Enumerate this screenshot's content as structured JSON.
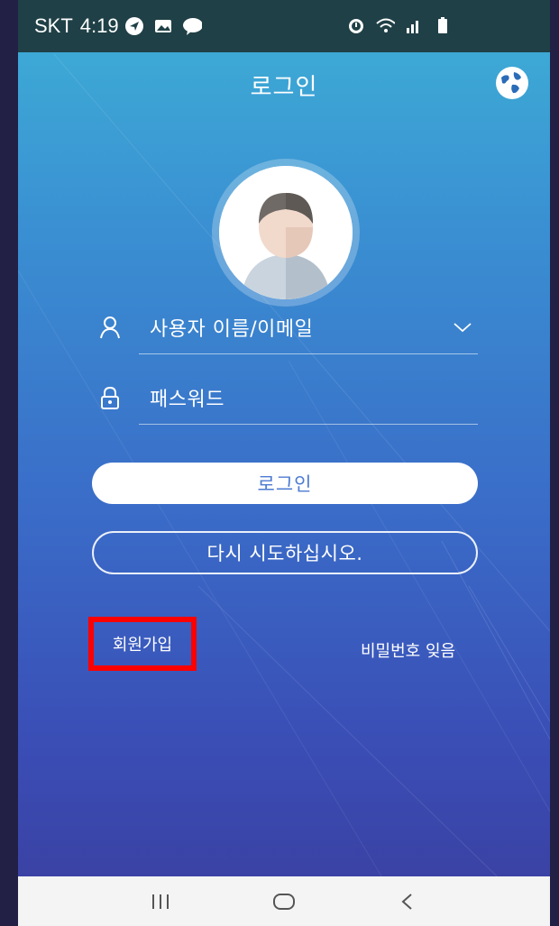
{
  "status_bar": {
    "carrier": "SKT",
    "time": "4:19"
  },
  "header": {
    "title": "로그인"
  },
  "form": {
    "username_placeholder": "사용자 이름/이메일",
    "password_placeholder": "패스워드",
    "login_button": "로그인",
    "retry_button": "다시 시도하십시오."
  },
  "links": {
    "signup": "회원가입",
    "forgot_password": "비밀번호 잊음"
  },
  "icons": {
    "globe": "globe-icon",
    "user": "user-icon",
    "lock": "lock-icon",
    "dropdown": "chevron-down-icon"
  },
  "colors": {
    "accent": "#4d7bd2",
    "highlight": "#ff0000"
  }
}
